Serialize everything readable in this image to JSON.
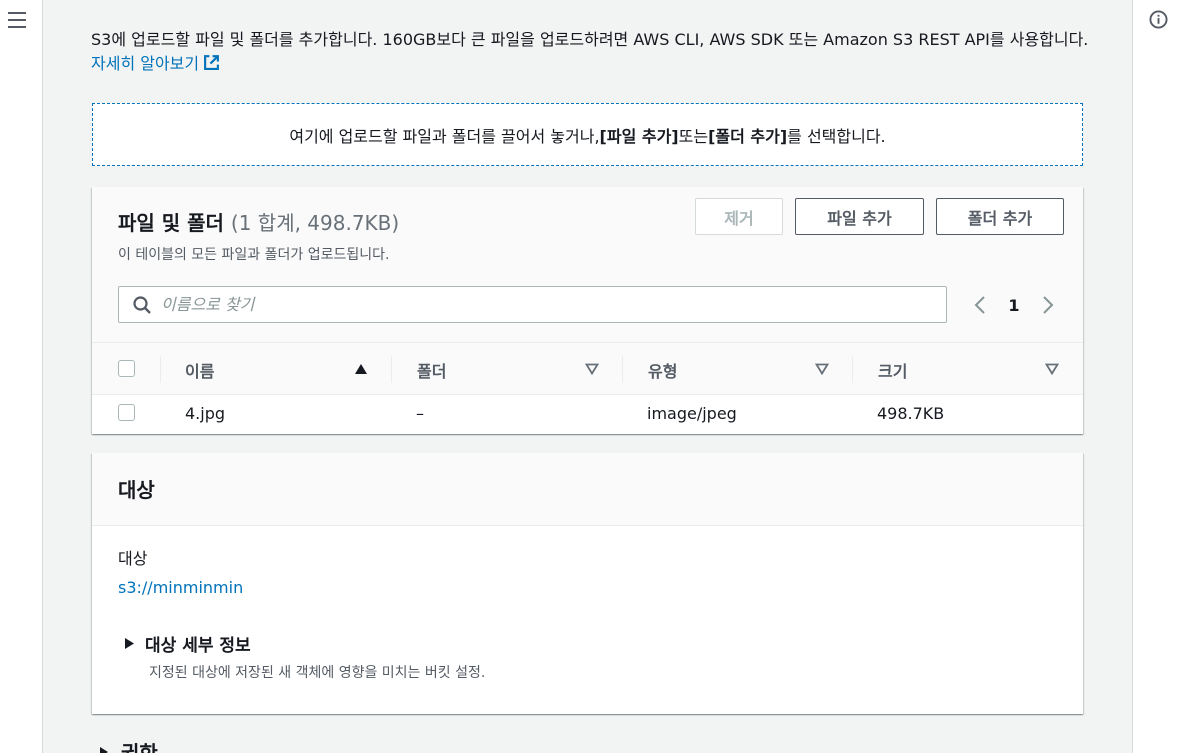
{
  "intro": {
    "text": "S3에 업로드할 파일 및 폴더를 추가합니다. 160GB보다 큰 파일을 업로드하려면 AWS CLI, AWS SDK 또는 Amazon S3 REST API를 사용합니다.",
    "learn_more": "자세히 알아보기"
  },
  "dropzone": {
    "prefix": "여기에 업로드할 파일과 폴더를 끌어서 놓거나, ",
    "add_files": "[파일 추가]",
    "or": " 또는 ",
    "add_folder": "[폴더 추가]",
    "suffix": "를 선택합니다."
  },
  "files": {
    "title": "파일 및 폴더",
    "count": "(1 합계, 498.7KB)",
    "description": "이 테이블의 모든 파일과 폴더가 업로드됩니다.",
    "remove_label": "제거",
    "add_files_label": "파일 추가",
    "add_folder_label": "폴더 추가",
    "search_placeholder": "이름으로 찾기",
    "page": "1",
    "columns": {
      "name": "이름",
      "folder": "폴더",
      "type": "유형",
      "size": "크기"
    },
    "rows": [
      {
        "name": "4.jpg",
        "folder": "–",
        "type": "image/jpeg",
        "size": "498.7KB"
      }
    ]
  },
  "destination": {
    "title": "대상",
    "label": "대상",
    "value": "s3://minminmin",
    "details_label": "대상 세부 정보",
    "details_desc": "지정된 대상에 저장된 새 객체에 영향을 미치는 버킷 설정."
  },
  "next_section": {
    "label": "권한"
  },
  "colors": {
    "link": "#0073bb",
    "text": "#16191f",
    "muted": "#545b64",
    "background": "#f2f3f3"
  }
}
